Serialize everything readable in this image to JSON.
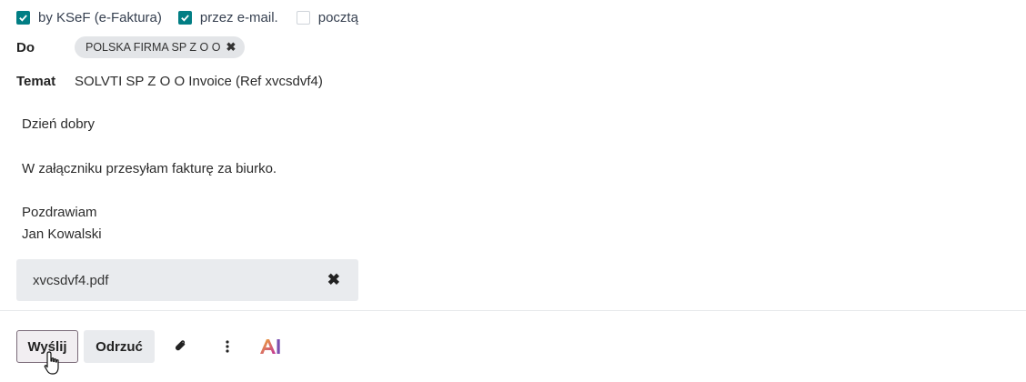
{
  "delivery": {
    "options": [
      {
        "label": "by KSeF (e-Faktura)",
        "checked": true
      },
      {
        "label": "przez e-mail.",
        "checked": true
      },
      {
        "label": "pocztą",
        "checked": false
      }
    ]
  },
  "recipients": {
    "label": "Do",
    "tags": [
      "POLSKA FIRMA SP Z O O"
    ]
  },
  "subject": {
    "label": "Temat",
    "value": "SOLVTI SP Z O O Invoice (Ref xvcsdvf4)"
  },
  "body": {
    "greeting": "Dzień dobry",
    "line1": "W załączniku przesyłam fakturę za biurko.",
    "closing": "Pozdrawiam",
    "signature": "Jan Kowalski"
  },
  "attachment": {
    "filename": "xvcsdvf4.pdf"
  },
  "footer": {
    "send_label": "Wyślij",
    "discard_label": "Odrzuć",
    "icons": [
      "paperclip-icon",
      "more-vertical-icon",
      "ai-icon"
    ],
    "ai_label": "AI"
  },
  "colors": {
    "checkbox": "#017e84",
    "ai_icon": "#e0a020"
  }
}
